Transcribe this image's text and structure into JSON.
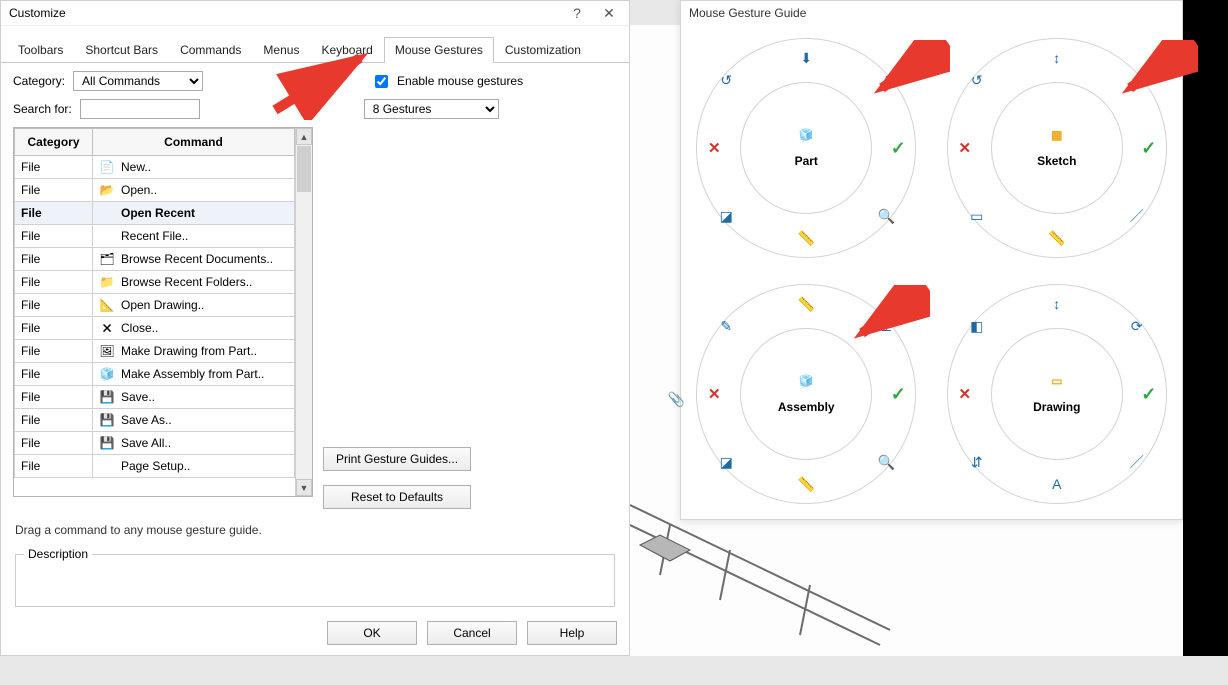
{
  "dialog": {
    "title": "Customize",
    "tabs": [
      "Toolbars",
      "Shortcut Bars",
      "Commands",
      "Menus",
      "Keyboard",
      "Mouse Gestures",
      "Customization"
    ],
    "active_tab": 5,
    "category_label": "Category:",
    "category_value": "All Commands",
    "search_label": "Search for:",
    "search_value": "",
    "enable_label": "Enable mouse gestures",
    "enable_checked": true,
    "gesture_count_value": "8 Gestures",
    "table_headers": {
      "category": "Category",
      "command": "Command"
    },
    "commands": [
      {
        "cat": "File",
        "label": "New..",
        "icon": "new-doc-icon"
      },
      {
        "cat": "File",
        "label": "Open..",
        "icon": "open-folder-icon"
      },
      {
        "cat": "File",
        "label": "Open Recent",
        "icon": "",
        "selected": true
      },
      {
        "cat": "File",
        "label": "Recent File..",
        "icon": ""
      },
      {
        "cat": "File",
        "label": "Browse Recent Documents..",
        "icon": "recent-docs-icon"
      },
      {
        "cat": "File",
        "label": "Browse Recent Folders..",
        "icon": "recent-folders-icon"
      },
      {
        "cat": "File",
        "label": "Open Drawing..",
        "icon": "open-drawing-icon"
      },
      {
        "cat": "File",
        "label": "Close..",
        "icon": "close-doc-icon"
      },
      {
        "cat": "File",
        "label": "Make Drawing from Part..",
        "icon": "make-drawing-icon"
      },
      {
        "cat": "File",
        "label": "Make Assembly from Part..",
        "icon": "make-assembly-icon"
      },
      {
        "cat": "File",
        "label": "Save..",
        "icon": "save-icon"
      },
      {
        "cat": "File",
        "label": "Save As..",
        "icon": "save-as-icon"
      },
      {
        "cat": "File",
        "label": "Save All..",
        "icon": "save-all-icon"
      },
      {
        "cat": "File",
        "label": "Page Setup..",
        "icon": ""
      }
    ],
    "print_btn": "Print Gesture Guides...",
    "reset_btn": "Reset to Defaults",
    "hint": "Drag a command to any mouse gesture guide.",
    "description_legend": "Description",
    "buttons": {
      "ok": "OK",
      "cancel": "Cancel",
      "help": "Help"
    }
  },
  "gesture_guide": {
    "title": "Mouse Gesture Guide",
    "wheels": [
      {
        "name": "Part",
        "center_icon": "part-cube-icon",
        "positions": {
          "n": "front-view-icon",
          "ne": "normal-to-icon",
          "e": "accept-icon",
          "se": "zoom-fit-icon",
          "s": "measure-icon",
          "sw": "section-view-icon",
          "w": "cancel-icon",
          "nw": "previous-view-icon"
        }
      },
      {
        "name": "Sketch",
        "center_icon": "sketch-grid-icon",
        "positions": {
          "n": "dimension-icon",
          "ne": "normal-to-icon",
          "e": "accept-icon",
          "se": "line-icon",
          "s": "measure-icon",
          "sw": "rectangle-icon",
          "w": "cancel-icon",
          "nw": "previous-view-icon"
        }
      },
      {
        "name": "Assembly",
        "center_icon": "assembly-cubes-icon",
        "positions": {
          "n": "measure-tape-icon",
          "ne": "normal-to-icon",
          "e": "accept-icon",
          "se": "zoom-fit-icon",
          "s": "measure-icon",
          "sw": "section-view-icon",
          "w": "cancel-icon",
          "nw": "edit-component-icon"
        },
        "extra_left": "paperclip-icon"
      },
      {
        "name": "Drawing",
        "center_icon": "drawing-sheet-icon",
        "positions": {
          "n": "dimension-icon",
          "ne": "rotate-view-icon",
          "e": "accept-icon",
          "se": "line-icon",
          "s": "annotation-icon",
          "sw": "flip-icon",
          "w": "cancel-icon",
          "nw": "model-items-icon"
        }
      }
    ]
  },
  "icon_glyphs": {
    "new-doc-icon": "📄",
    "open-folder-icon": "📂",
    "recent-docs-icon": "🗂",
    "recent-folders-icon": "📁",
    "open-drawing-icon": "📐",
    "close-doc-icon": "🗙",
    "make-drawing-icon": "🖼",
    "make-assembly-icon": "🧊",
    "save-icon": "💾",
    "save-as-icon": "💾",
    "save-all-icon": "💾",
    "part-cube-icon": "🧊",
    "sketch-grid-icon": "▦",
    "assembly-cubes-icon": "🧊",
    "drawing-sheet-icon": "▭",
    "front-view-icon": "⬇",
    "normal-to-icon": "⟂",
    "accept-icon": "✔",
    "cancel-icon": "✕",
    "zoom-fit-icon": "🔍",
    "measure-icon": "📏",
    "section-view-icon": "◪",
    "previous-view-icon": "↺",
    "dimension-icon": "↕",
    "line-icon": "／",
    "rectangle-icon": "▭",
    "measure-tape-icon": "📏",
    "edit-component-icon": "✎",
    "paperclip-icon": "📎",
    "rotate-view-icon": "⟳",
    "annotation-icon": "A",
    "flip-icon": "⇵",
    "model-items-icon": "◧"
  },
  "colors": {
    "accent_green": "#2fa83f",
    "accent_red": "#d6302a",
    "icon_blue": "#1f6aa5",
    "icon_gold": "#f2a81d",
    "arrow": "#e8392f"
  }
}
